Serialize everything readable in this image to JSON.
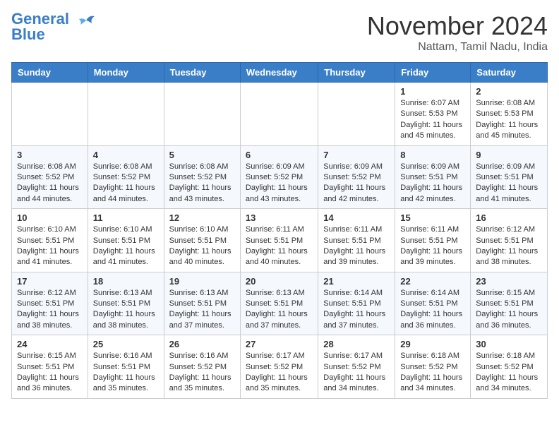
{
  "header": {
    "logo_line1": "General",
    "logo_line2": "Blue",
    "month_title": "November 2024",
    "location": "Nattam, Tamil Nadu, India"
  },
  "weekdays": [
    "Sunday",
    "Monday",
    "Tuesday",
    "Wednesday",
    "Thursday",
    "Friday",
    "Saturday"
  ],
  "weeks": [
    [
      {
        "day": "",
        "info": ""
      },
      {
        "day": "",
        "info": ""
      },
      {
        "day": "",
        "info": ""
      },
      {
        "day": "",
        "info": ""
      },
      {
        "day": "",
        "info": ""
      },
      {
        "day": "1",
        "info": "Sunrise: 6:07 AM\nSunset: 5:53 PM\nDaylight: 11 hours and 45 minutes."
      },
      {
        "day": "2",
        "info": "Sunrise: 6:08 AM\nSunset: 5:53 PM\nDaylight: 11 hours and 45 minutes."
      }
    ],
    [
      {
        "day": "3",
        "info": "Sunrise: 6:08 AM\nSunset: 5:52 PM\nDaylight: 11 hours and 44 minutes."
      },
      {
        "day": "4",
        "info": "Sunrise: 6:08 AM\nSunset: 5:52 PM\nDaylight: 11 hours and 44 minutes."
      },
      {
        "day": "5",
        "info": "Sunrise: 6:08 AM\nSunset: 5:52 PM\nDaylight: 11 hours and 43 minutes."
      },
      {
        "day": "6",
        "info": "Sunrise: 6:09 AM\nSunset: 5:52 PM\nDaylight: 11 hours and 43 minutes."
      },
      {
        "day": "7",
        "info": "Sunrise: 6:09 AM\nSunset: 5:52 PM\nDaylight: 11 hours and 42 minutes."
      },
      {
        "day": "8",
        "info": "Sunrise: 6:09 AM\nSunset: 5:51 PM\nDaylight: 11 hours and 42 minutes."
      },
      {
        "day": "9",
        "info": "Sunrise: 6:09 AM\nSunset: 5:51 PM\nDaylight: 11 hours and 41 minutes."
      }
    ],
    [
      {
        "day": "10",
        "info": "Sunrise: 6:10 AM\nSunset: 5:51 PM\nDaylight: 11 hours and 41 minutes."
      },
      {
        "day": "11",
        "info": "Sunrise: 6:10 AM\nSunset: 5:51 PM\nDaylight: 11 hours and 41 minutes."
      },
      {
        "day": "12",
        "info": "Sunrise: 6:10 AM\nSunset: 5:51 PM\nDaylight: 11 hours and 40 minutes."
      },
      {
        "day": "13",
        "info": "Sunrise: 6:11 AM\nSunset: 5:51 PM\nDaylight: 11 hours and 40 minutes."
      },
      {
        "day": "14",
        "info": "Sunrise: 6:11 AM\nSunset: 5:51 PM\nDaylight: 11 hours and 39 minutes."
      },
      {
        "day": "15",
        "info": "Sunrise: 6:11 AM\nSunset: 5:51 PM\nDaylight: 11 hours and 39 minutes."
      },
      {
        "day": "16",
        "info": "Sunrise: 6:12 AM\nSunset: 5:51 PM\nDaylight: 11 hours and 38 minutes."
      }
    ],
    [
      {
        "day": "17",
        "info": "Sunrise: 6:12 AM\nSunset: 5:51 PM\nDaylight: 11 hours and 38 minutes."
      },
      {
        "day": "18",
        "info": "Sunrise: 6:13 AM\nSunset: 5:51 PM\nDaylight: 11 hours and 38 minutes."
      },
      {
        "day": "19",
        "info": "Sunrise: 6:13 AM\nSunset: 5:51 PM\nDaylight: 11 hours and 37 minutes."
      },
      {
        "day": "20",
        "info": "Sunrise: 6:13 AM\nSunset: 5:51 PM\nDaylight: 11 hours and 37 minutes."
      },
      {
        "day": "21",
        "info": "Sunrise: 6:14 AM\nSunset: 5:51 PM\nDaylight: 11 hours and 37 minutes."
      },
      {
        "day": "22",
        "info": "Sunrise: 6:14 AM\nSunset: 5:51 PM\nDaylight: 11 hours and 36 minutes."
      },
      {
        "day": "23",
        "info": "Sunrise: 6:15 AM\nSunset: 5:51 PM\nDaylight: 11 hours and 36 minutes."
      }
    ],
    [
      {
        "day": "24",
        "info": "Sunrise: 6:15 AM\nSunset: 5:51 PM\nDaylight: 11 hours and 36 minutes."
      },
      {
        "day": "25",
        "info": "Sunrise: 6:16 AM\nSunset: 5:51 PM\nDaylight: 11 hours and 35 minutes."
      },
      {
        "day": "26",
        "info": "Sunrise: 6:16 AM\nSunset: 5:52 PM\nDaylight: 11 hours and 35 minutes."
      },
      {
        "day": "27",
        "info": "Sunrise: 6:17 AM\nSunset: 5:52 PM\nDaylight: 11 hours and 35 minutes."
      },
      {
        "day": "28",
        "info": "Sunrise: 6:17 AM\nSunset: 5:52 PM\nDaylight: 11 hours and 34 minutes."
      },
      {
        "day": "29",
        "info": "Sunrise: 6:18 AM\nSunset: 5:52 PM\nDaylight: 11 hours and 34 minutes."
      },
      {
        "day": "30",
        "info": "Sunrise: 6:18 AM\nSunset: 5:52 PM\nDaylight: 11 hours and 34 minutes."
      }
    ]
  ]
}
